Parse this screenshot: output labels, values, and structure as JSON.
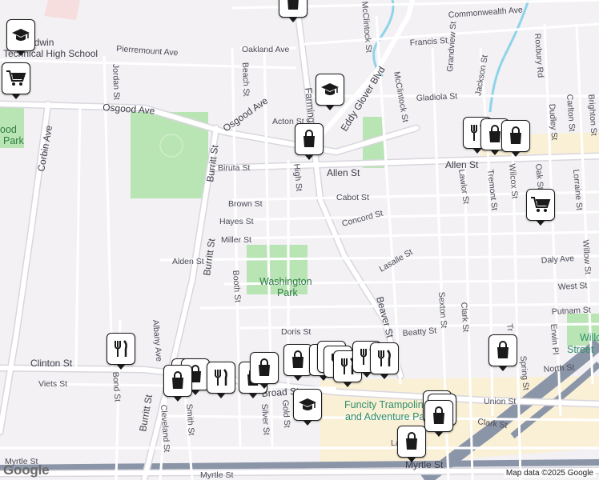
{
  "attribution": "Map data ©2025 Google",
  "google_logo": "Google",
  "streets": [
    {
      "id": "commonwealth",
      "label": "Commonwealth Ave"
    },
    {
      "id": "mcclintock-top",
      "label": "McClintock St"
    },
    {
      "id": "francis",
      "label": "Francis St"
    },
    {
      "id": "oakland",
      "label": "Oakland Ave"
    },
    {
      "id": "pierremount",
      "label": "Pierremount Ave"
    },
    {
      "id": "jordan",
      "label": "Jordan St"
    },
    {
      "id": "beach",
      "label": "Beach St"
    },
    {
      "id": "osgood-w",
      "label": "Osgood Ave"
    },
    {
      "id": "osgood-e",
      "label": "Osgood Ave"
    },
    {
      "id": "acton",
      "label": "Acton St"
    },
    {
      "id": "farmington",
      "label": "Farmington Ave"
    },
    {
      "id": "eddy-glover",
      "label": "Eddy Glover Blvd"
    },
    {
      "id": "mcclintock-mid",
      "label": "McClintock St"
    },
    {
      "id": "grandview",
      "label": "Grandview St"
    },
    {
      "id": "jackson",
      "label": "Jackson St"
    },
    {
      "id": "roxbury",
      "label": "Roxbury Rd"
    },
    {
      "id": "gladiola",
      "label": "Gladiola St"
    },
    {
      "id": "dudley",
      "label": "Dudley St"
    },
    {
      "id": "carlton",
      "label": "Carlton St"
    },
    {
      "id": "brighton",
      "label": "Brighton St"
    },
    {
      "id": "corbin",
      "label": "Corbin Ave"
    },
    {
      "id": "burritt-n",
      "label": "Burritt St"
    },
    {
      "id": "biruta",
      "label": "Biruta St"
    },
    {
      "id": "allen-w",
      "label": "Allen St"
    },
    {
      "id": "allen-e",
      "label": "Allen St"
    },
    {
      "id": "high",
      "label": "High St"
    },
    {
      "id": "brown",
      "label": "Brown St"
    },
    {
      "id": "cabot",
      "label": "Cabot St"
    },
    {
      "id": "lawlor",
      "label": "Lawlor St"
    },
    {
      "id": "tremont",
      "label": "Tremont St"
    },
    {
      "id": "wilcox",
      "label": "Wilcox St"
    },
    {
      "id": "oak",
      "label": "Oak St"
    },
    {
      "id": "lorraine",
      "label": "Lorraine St"
    },
    {
      "id": "hayes",
      "label": "Hayes St"
    },
    {
      "id": "concord",
      "label": "Concord St"
    },
    {
      "id": "miller",
      "label": "Miller St"
    },
    {
      "id": "burritt-mid",
      "label": "Burritt St"
    },
    {
      "id": "alden",
      "label": "Alden St"
    },
    {
      "id": "lasalle",
      "label": "Lasalle St"
    },
    {
      "id": "daly",
      "label": "Daly Ave"
    },
    {
      "id": "willow",
      "label": "Willow St"
    },
    {
      "id": "booth",
      "label": "Booth St"
    },
    {
      "id": "west",
      "label": "West St"
    },
    {
      "id": "sexton",
      "label": "Sexton St"
    },
    {
      "id": "clark-n",
      "label": "Clark St"
    },
    {
      "id": "putnam",
      "label": "Putnam St"
    },
    {
      "id": "albany",
      "label": "Albany Ave"
    },
    {
      "id": "beaver",
      "label": "Beaver St"
    },
    {
      "id": "doris",
      "label": "Doris St"
    },
    {
      "id": "beatty",
      "label": "Beatty St"
    },
    {
      "id": "tr-stub",
      "label": "Tr"
    },
    {
      "id": "erwin",
      "label": "Erwin Pl"
    },
    {
      "id": "clinton",
      "label": "Clinton St"
    },
    {
      "id": "spring",
      "label": "Spring St"
    },
    {
      "id": "north",
      "label": "North St"
    },
    {
      "id": "viets",
      "label": "Viets St"
    },
    {
      "id": "bond",
      "label": "Bond St"
    },
    {
      "id": "broad",
      "label": "Broad St"
    },
    {
      "id": "union",
      "label": "Union St"
    },
    {
      "id": "burritt-s",
      "label": "Burritt St"
    },
    {
      "id": "cleveland",
      "label": "Cleveland St"
    },
    {
      "id": "smith",
      "label": "Smith St"
    },
    {
      "id": "silver",
      "label": "Silver St"
    },
    {
      "id": "gold",
      "label": "Gold St"
    },
    {
      "id": "clark-s",
      "label": "Clark St"
    },
    {
      "id": "la-stub",
      "label": "La"
    },
    {
      "id": "myrtle-w",
      "label": "Myrtle St"
    },
    {
      "id": "myrtle-mid",
      "label": "Myrtle St"
    },
    {
      "id": "myrtle-e",
      "label": "Myrtle St"
    }
  ],
  "places": {
    "school_line1": "E     Baldwin",
    "school_line2": "Technical High School",
    "park_line1": "Washington",
    "park_line2": "Park",
    "funcity_line1": "Funcity Trampoline",
    "funcity_line2": "and Adventure Park",
    "willow_line1": "Willo",
    "willow_line2": "Street",
    "left_park_line1": "ood",
    "left_park_line2": "Park"
  },
  "pins": [
    {
      "type": "shopping-bag",
      "label": "shopping"
    },
    {
      "type": "education",
      "label": "school"
    },
    {
      "type": "shopping-cart",
      "label": "grocery"
    },
    {
      "type": "education",
      "label": "school"
    },
    {
      "type": "shopping-bag",
      "label": "shopping"
    },
    {
      "type": "restaurant",
      "label": "restaurant"
    },
    {
      "type": "shopping-bag",
      "label": "shopping"
    },
    {
      "type": "shopping-bag",
      "label": "shopping"
    },
    {
      "type": "shopping-cart",
      "label": "grocery"
    },
    {
      "type": "restaurant",
      "label": "restaurant"
    },
    {
      "type": "shopping-bag",
      "label": "shopping"
    },
    {
      "type": "shopping-bag",
      "label": "shopping"
    },
    {
      "type": "shopping-bag",
      "label": "shopping"
    },
    {
      "type": "restaurant",
      "label": "restaurant"
    },
    {
      "type": "shopping-bag",
      "label": "shopping"
    },
    {
      "type": "shopping-bag",
      "label": "shopping"
    },
    {
      "type": "shopping-bag",
      "label": "shopping"
    },
    {
      "type": "shopping-bag",
      "label": "shopping"
    },
    {
      "type": "restaurant",
      "label": "restaurant"
    },
    {
      "type": "restaurant",
      "label": "restaurant"
    },
    {
      "type": "restaurant",
      "label": "restaurant"
    },
    {
      "type": "restaurant",
      "label": "restaurant"
    },
    {
      "type": "restaurant",
      "label": "restaurant"
    },
    {
      "type": "education",
      "label": "school"
    },
    {
      "type": "shopping-bag",
      "label": "shopping"
    },
    {
      "type": "shopping-bag",
      "label": "shopping"
    },
    {
      "type": "shopping-bag",
      "label": "shopping"
    },
    {
      "type": "shopping-bag",
      "label": "shopping"
    },
    {
      "type": "shopping-bag",
      "label": "shopping"
    }
  ],
  "colors": {
    "background": "#f3f1f4",
    "road": "#ffffff",
    "road_edge": "#d9d6de",
    "park": "#b9e5b4",
    "water": "#8fd3ea",
    "highway": "#8b95a8",
    "commercial": "#faf0d6"
  }
}
